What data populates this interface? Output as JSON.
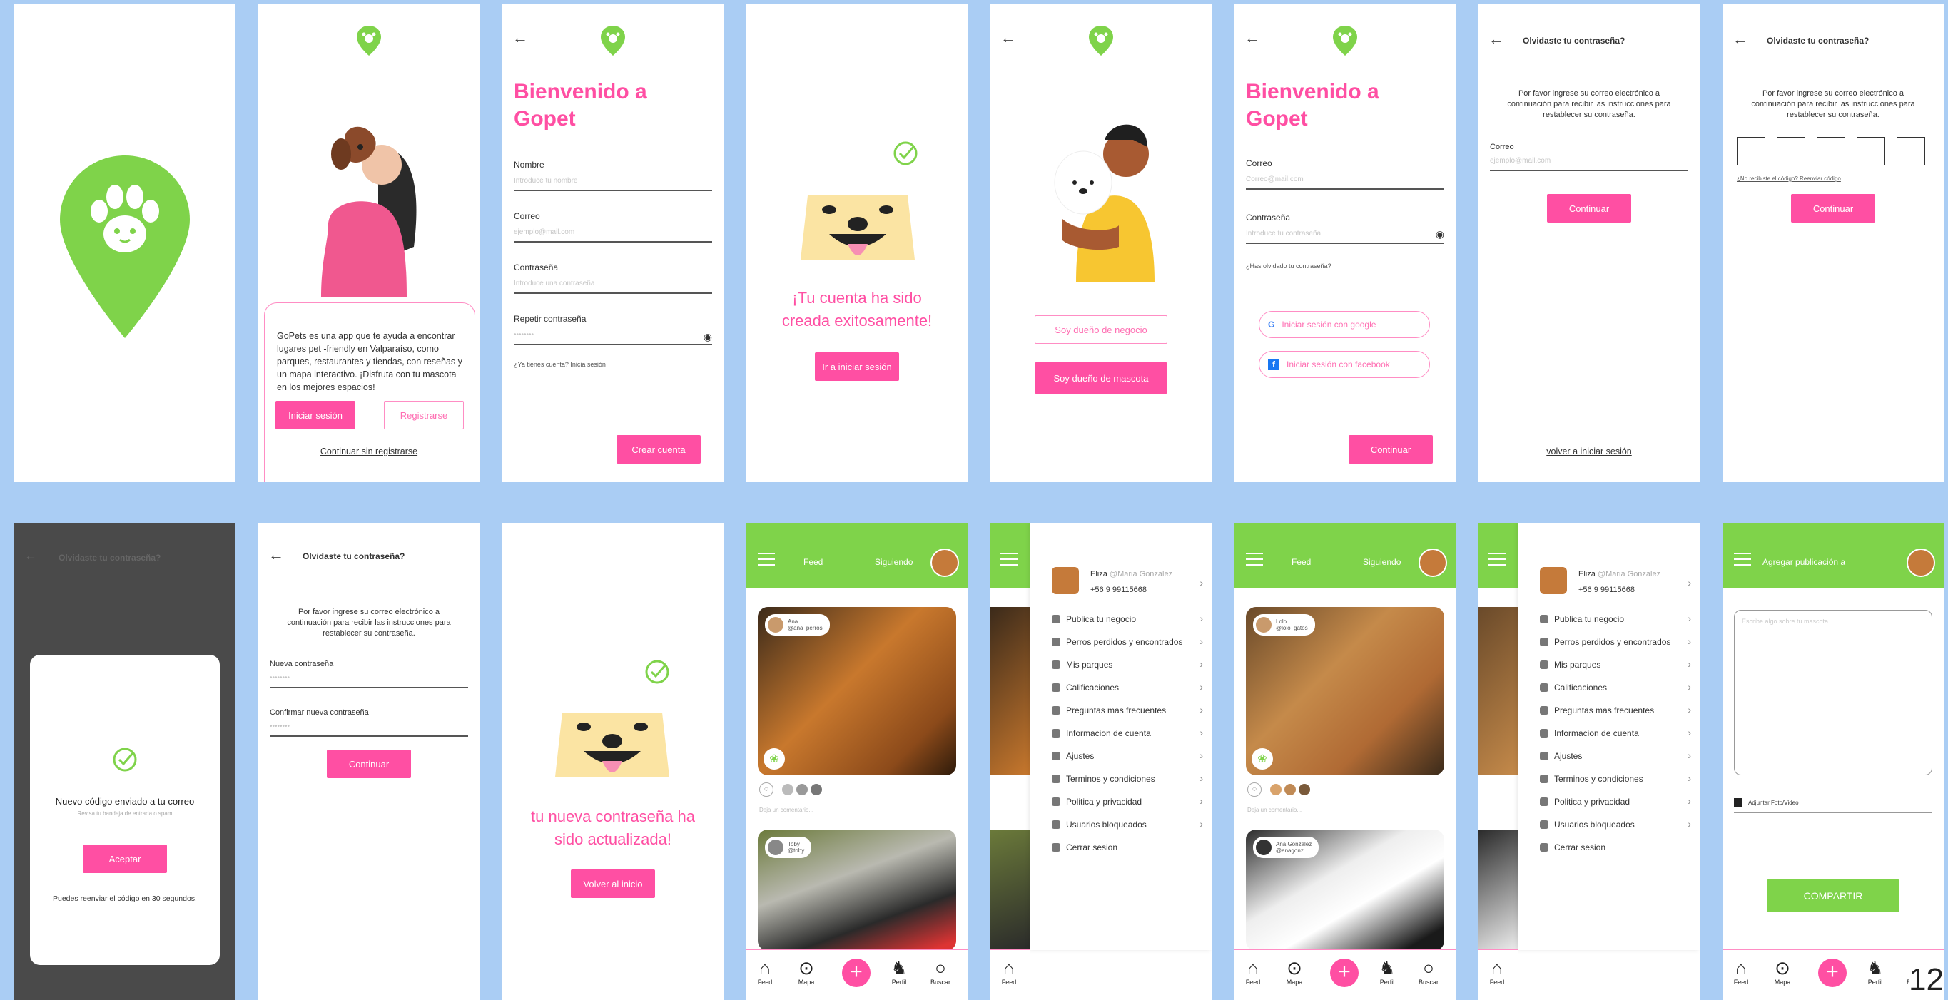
{
  "colors": {
    "pink": "#ff4fa3",
    "green": "#7fd34a",
    "bg": "#aacdf4"
  },
  "page_number": "12",
  "s2": {
    "desc": "GoPets es una app que te ayuda a encontrar lugares pet -friendly en Valparaíso, como parques, restaurantes y tiendas, con reseñas y un mapa interactivo. ¡Disfruta con tu mascota en los mejores espacios!",
    "login": "Iniciar sesión",
    "register": "Registrarse",
    "skip": "Continuar sin registrarse"
  },
  "s3": {
    "title": "Bienvenido a Gopet",
    "name_label": "Nombre",
    "name_ph": "Introduce tu nombre",
    "email_label": "Correo",
    "email_ph": "ejemplo@mail.com",
    "pass_label": "Contraseña",
    "pass_ph": "Introduce una contraseña",
    "repeat_label": "Repetir contraseña",
    "repeat_ph": "••••••••",
    "account_note": "¿Ya tienes cuenta? Inicia sesión",
    "cta": "Crear cuenta"
  },
  "s4": {
    "msg": "¡Tu cuenta ha sido creada exitosamente!",
    "cta": "Ir a iniciar sesión"
  },
  "s5": {
    "business": "Soy dueño de negocio",
    "pet_owner": "Soy dueño de mascota"
  },
  "s6": {
    "title": "Bienvenido a Gopet",
    "email_label": "Correo",
    "email_ph": "Correo@mail.com",
    "pass_label": "Contraseña",
    "pass_ph": "Introduce tu contraseña",
    "forgot": "¿Has olvidado tu contraseña?",
    "google": "Iniciar sesión con google",
    "facebook": "Iniciar sesión con facebook",
    "cta": "Continuar"
  },
  "s7": {
    "title": "Olvidaste tu contraseña?",
    "desc": "Por favor ingrese su correo electrónico a continuación para recibir las instrucciones para restablecer su contraseña.",
    "email_label": "Correo",
    "email_ph": "ejemplo@mail.com",
    "cta": "Continuar",
    "back": "volver a iniciar sesión"
  },
  "s8": {
    "title": "Olvidaste tu contraseña?",
    "desc": "Por favor ingrese su correo electrónico a continuación para recibir las instrucciones para restablecer su contraseña.",
    "resend": "¿No recibiste el código? Reenviar código",
    "cta": "Continuar"
  },
  "s9": {
    "title": "Olvidaste tu contraseña?",
    "modal_title": "Nuevo código enviado a tu correo",
    "modal_sub": "Revisa tu bandeja de entrada o spam",
    "cta": "Aceptar",
    "resend": "Puedes reenviar el código en 30 segundos."
  },
  "s10": {
    "title": "Olvidaste tu contraseña?",
    "desc": "Por favor ingrese su correo electrónico a continuación para recibir las instrucciones para restablecer su contraseña.",
    "new_label": "Nueva contraseña",
    "new_ph": "••••••••",
    "confirm_label": "Confirmar nueva contraseña",
    "confirm_ph": "••••••••",
    "cta": "Continuar"
  },
  "s11": {
    "msg": "tu nueva contraseña ha sido actualizada!",
    "cta": "Volver al inicio"
  },
  "feed": {
    "tab_feed": "Feed",
    "tab_following": "Siguiendo",
    "post1_user": "Ana",
    "post1_handle": "@ana_perros",
    "post2_user": "Toby",
    "post2_handle": "@toby",
    "comment_ph": "Deja un comentario..."
  },
  "feed2": {
    "post1_user": "Lolo",
    "post1_handle": "@lolo_gatos",
    "post2_user": "Ana Gonzalez",
    "post2_handle": "@anagonz"
  },
  "nav": {
    "feed": "Feed",
    "map": "Mapa",
    "profile": "Perfil",
    "search": "Buscar"
  },
  "menu": {
    "user_name": "Eliza",
    "user_handle": "@Maria Gonzalez",
    "user_phone": "+56 9 99115668",
    "items": [
      "Publica tu negocio",
      "Perros perdidos y encontrados",
      "Mis parques",
      "Calificaciones",
      "Preguntas mas frecuentes",
      "Informacion de cuenta",
      "Ajustes",
      "Terminos y condiciones",
      "Politica y privacidad",
      "Usuarios bloqueados",
      "Cerrar sesion"
    ]
  },
  "publish": {
    "title": "Agregar publicación a",
    "textarea_ph": "Escribe algo sobre tu mascota...",
    "attach": "Adjuntar Foto/Video",
    "cta": "COMPARTIR"
  }
}
